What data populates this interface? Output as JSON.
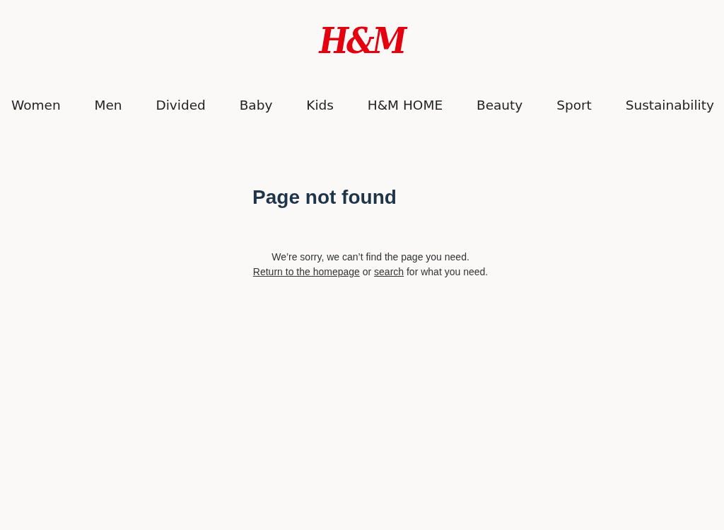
{
  "logo": "H&M",
  "nav": [
    "Women",
    "Men",
    "Divided",
    "Baby",
    "Kids",
    "H&M HOME",
    "Beauty",
    "Sport",
    "Sustainability"
  ],
  "title": "Page not found",
  "message": "We’re sorry, we can’t find the page you need.",
  "help": {
    "link_home": "Return to the homepage",
    "middle": "or",
    "link_search": "search",
    "end": "for what you need."
  }
}
